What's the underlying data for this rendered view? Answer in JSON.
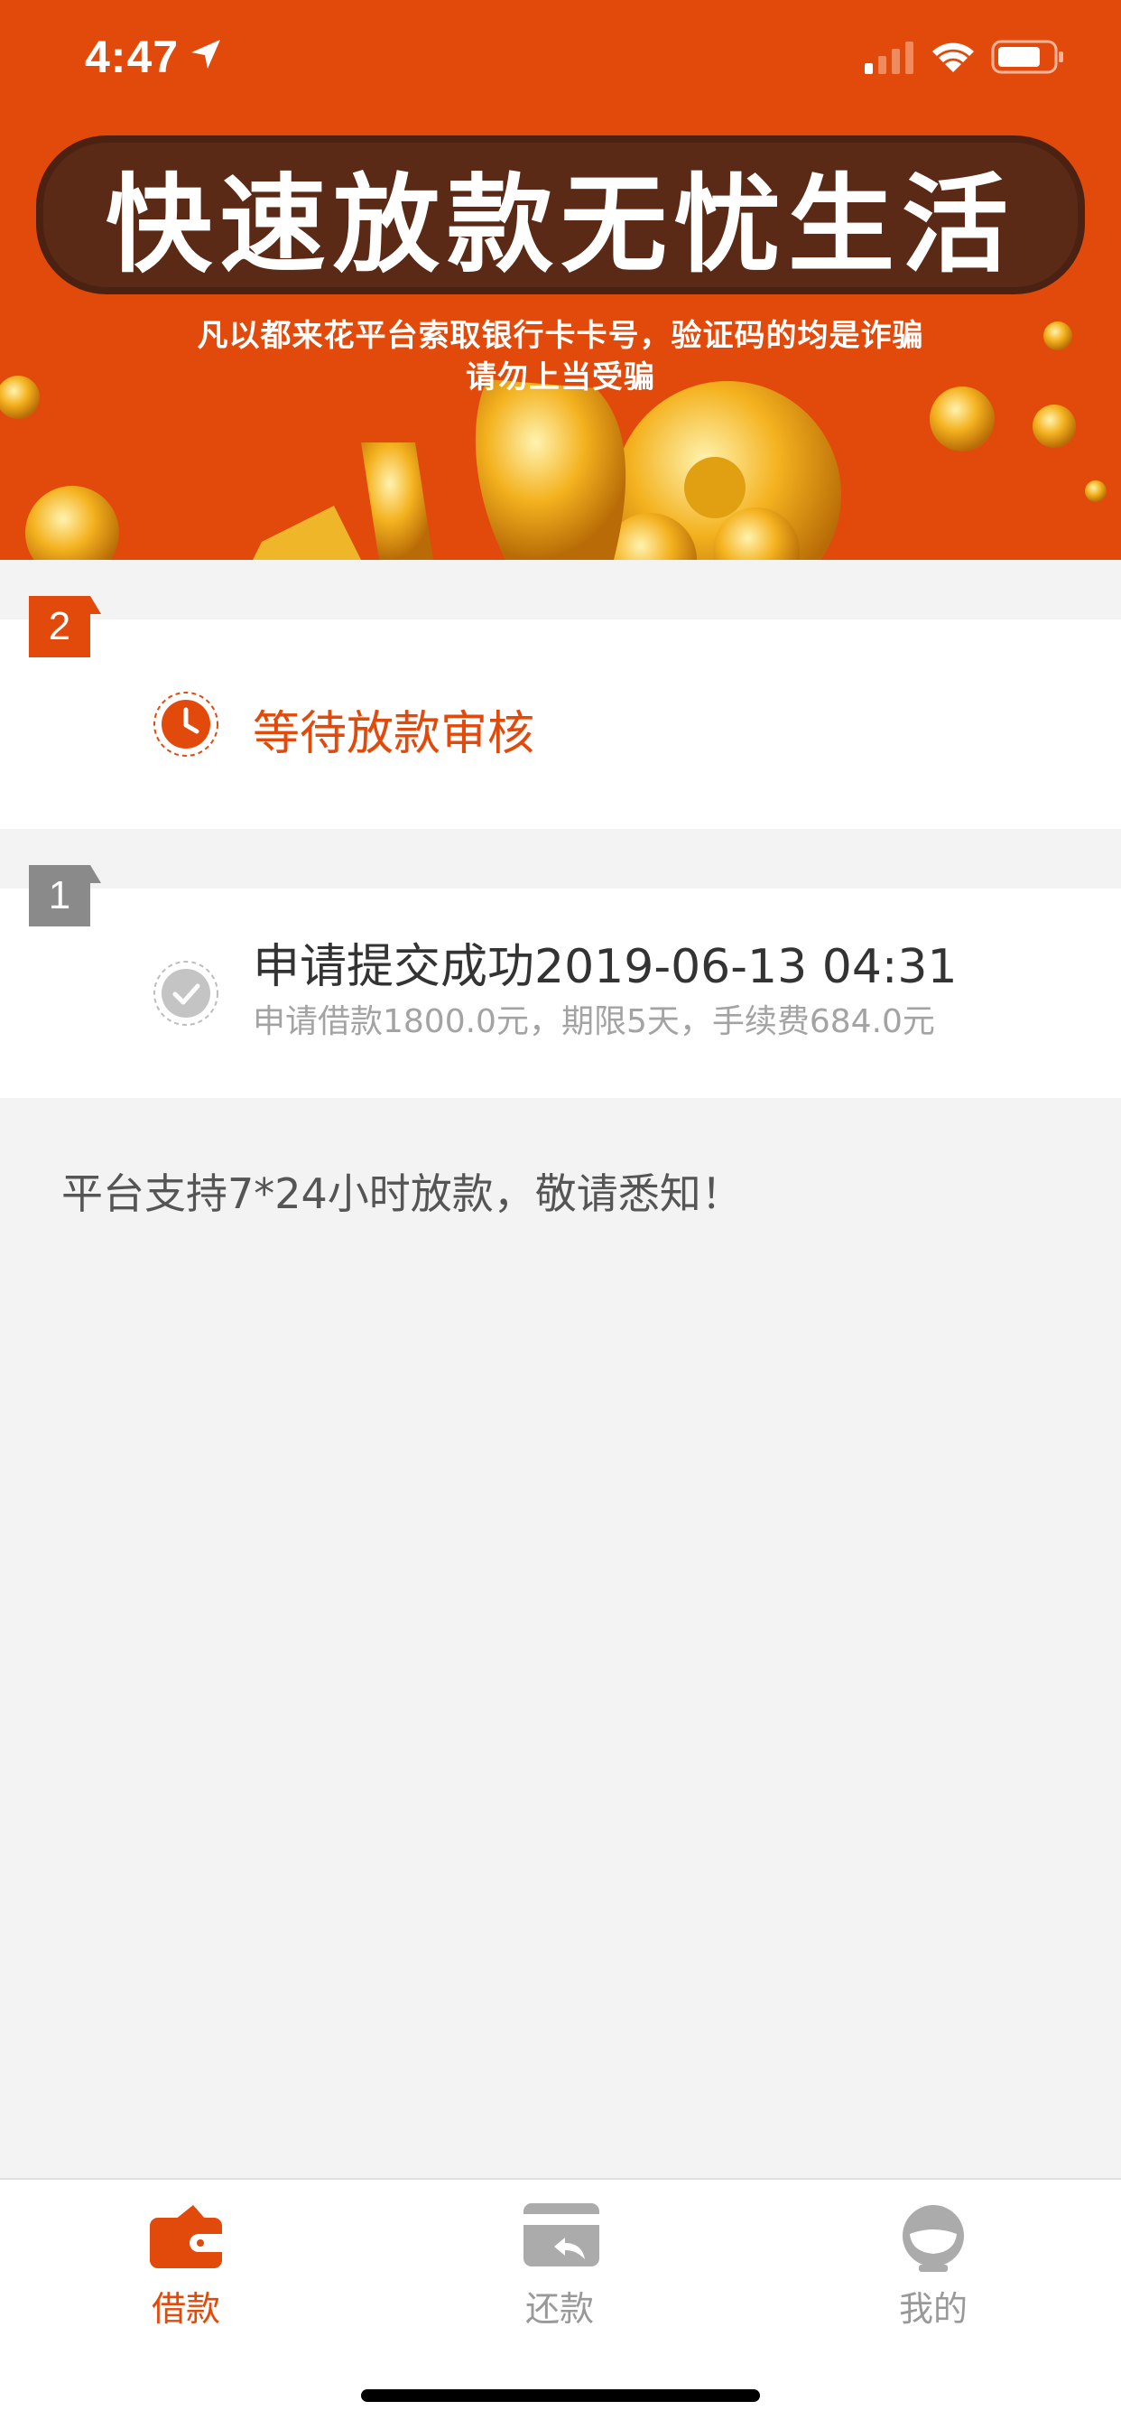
{
  "status_bar": {
    "time": "4:47"
  },
  "banner": {
    "headline": "快速放款无忧生活",
    "warning_line1": "凡以都来花平台索取银行卡卡号，验证码的均是诈骗",
    "warning_line2": "请勿上当受骗"
  },
  "steps": [
    {
      "number": "2",
      "title": "等待放款审核",
      "status": "pending"
    },
    {
      "number": "1",
      "title": "申请提交成功2019-06-13 04:31",
      "detail": "申请借款1800.0元，期限5天，手续费684.0元",
      "status": "done"
    }
  ],
  "notice": "平台支持7*24小时放款，敬请悉知！",
  "tabs": [
    {
      "label": "借款",
      "icon": "wallet-icon",
      "active": true
    },
    {
      "label": "还款",
      "icon": "repay-card-icon",
      "active": false
    },
    {
      "label": "我的",
      "icon": "profile-icon",
      "active": false
    }
  ],
  "colors": {
    "accent": "#e24a0c",
    "muted": "#8a8a8a",
    "background": "#f3f3f3"
  }
}
